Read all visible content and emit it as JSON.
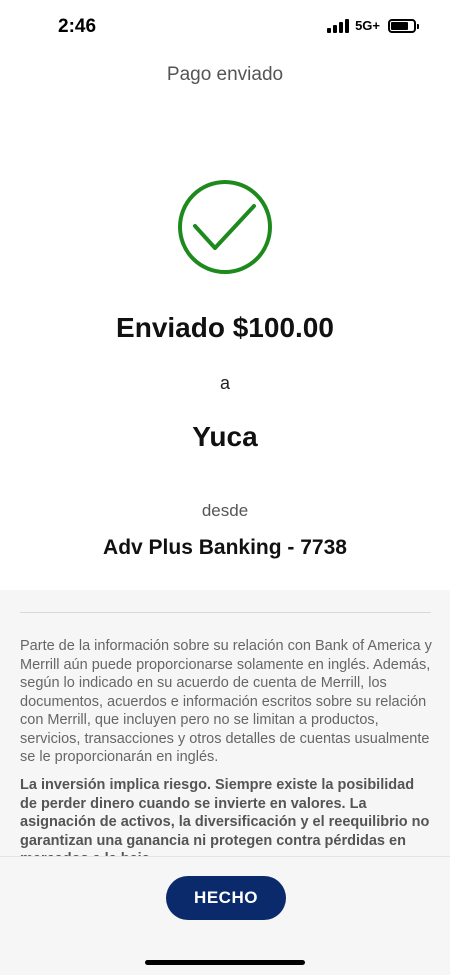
{
  "status_bar": {
    "time": "2:46",
    "network": "5G+",
    "battery_level": 0.78
  },
  "header": {
    "title": "Pago enviado"
  },
  "success_icon": "checkmark-circle-icon",
  "colors": {
    "success": "#1e8a1e",
    "primary_button": "#0a2a6b",
    "disclosure_bg": "#f6f6f6"
  },
  "confirmation": {
    "sent_amount": "Enviado $100.00",
    "to_label": "a",
    "recipient": "Yuca",
    "from_label": "desde",
    "account": "Adv Plus Banking - 7738"
  },
  "disclosure": {
    "paragraph": "Parte de la información sobre su relación con Bank of America y Merrill aún puede proporcionarse solamente en inglés. Además, según lo indicado en su acuerdo de cuenta de Merrill, los documentos, acuerdos e información escritos sobre su relación con Merrill, que incluyen pero no se limitan a productos, servicios, transacciones y otros detalles de cuentas usualmente se le proporcionarán en inglés.",
    "risk_paragraph": "La inversión implica riesgo. Siempre existe la posibilidad de perder dinero cuando se invierte en valores. La asignación de activos, la diversificación y el reequilibrio no garantizan una ganancia ni protegen contra pérdidas en mercados a la baja."
  },
  "actions": {
    "done_label": "HECHO"
  }
}
